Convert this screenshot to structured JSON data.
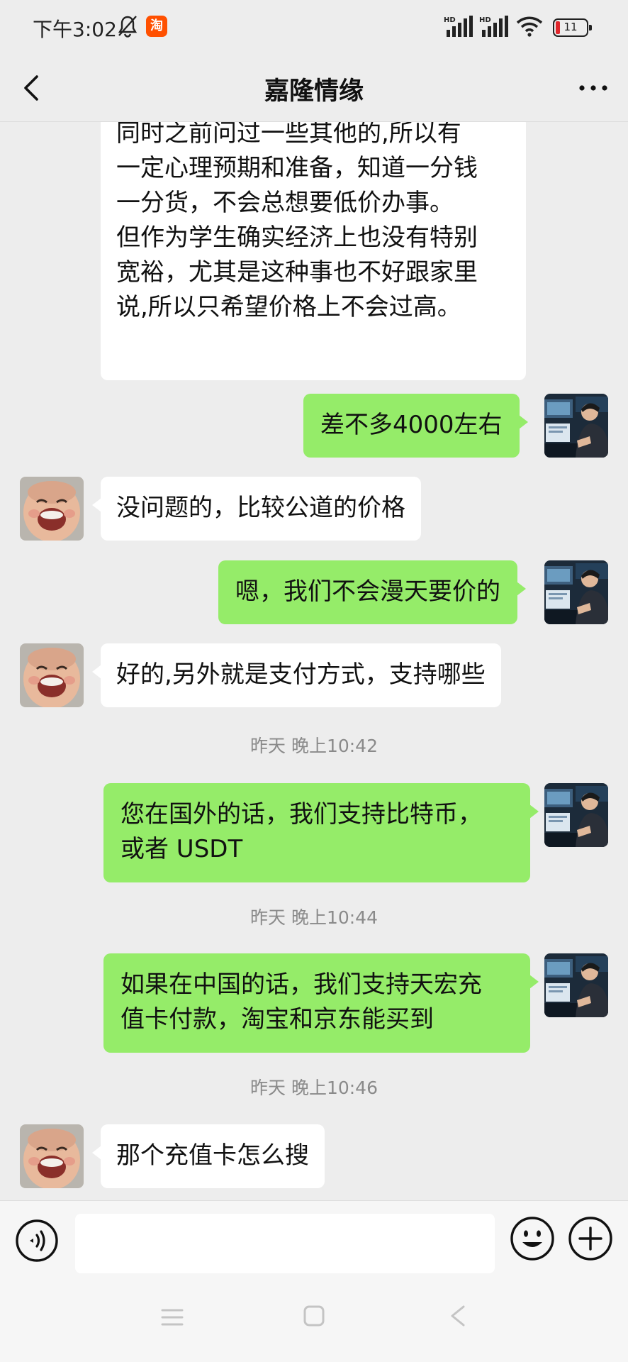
{
  "status_bar": {
    "time": "下午3:02",
    "taobao_icon_text": "淘",
    "signal_1_label": "HD",
    "signal_2_label": "HD",
    "battery_level": "11",
    "battery_color": "#e0262b"
  },
  "header": {
    "title": "嘉隆情缘",
    "back_icon": "chevron-left-icon",
    "more_icon": "more-horizontal-icon"
  },
  "colors": {
    "background": "#ededed",
    "incoming_bubble": "#ffffff",
    "outgoing_bubble": "#95ec69",
    "timestamp_text": "#8a8a8a"
  },
  "messages": [
    {
      "direction": "incoming",
      "lines": [
        "同时之前问过一些其他的,所以有",
        "一定心理预期和准备，知道一分钱",
        "一分货，不会总想要低价办事。",
        "但作为学生确实经济上也没有特别",
        "宽裕，尤其是这种事也不好跟家里",
        "说,所以只希望价格上不会过高。"
      ]
    },
    {
      "direction": "outgoing",
      "lines": [
        "差不多4000左右"
      ]
    },
    {
      "direction": "incoming",
      "lines": [
        "没问题的，比较公道的价格"
      ]
    },
    {
      "direction": "outgoing",
      "lines": [
        "嗯，我们不会漫天要价的"
      ]
    },
    {
      "direction": "incoming",
      "lines": [
        "好的,另外就是支付方式，支持哪些"
      ]
    },
    {
      "type": "timestamp",
      "text": "昨天 晚上10:42"
    },
    {
      "direction": "outgoing",
      "lines": [
        "您在国外的话，我们支持比特币，",
        "或者 USDT"
      ]
    },
    {
      "type": "timestamp",
      "text": "昨天 晚上10:44"
    },
    {
      "direction": "outgoing",
      "lines": [
        "如果在中国的话，我们支持天宏充",
        "值卡付款，淘宝和京东能买到"
      ]
    },
    {
      "type": "timestamp",
      "text": "昨天 晚上10:46"
    },
    {
      "direction": "incoming",
      "lines": [
        "那个充值卡怎么搜"
      ]
    }
  ],
  "input_bar": {
    "voice_icon": "voice-icon",
    "input_value": "",
    "emoji_icon": "emoji-icon",
    "plus_icon": "plus-circle-icon"
  },
  "nav_bar": {
    "menu_icon": "menu-icon",
    "home_icon": "square-icon",
    "back_icon": "back-triangle-icon"
  }
}
